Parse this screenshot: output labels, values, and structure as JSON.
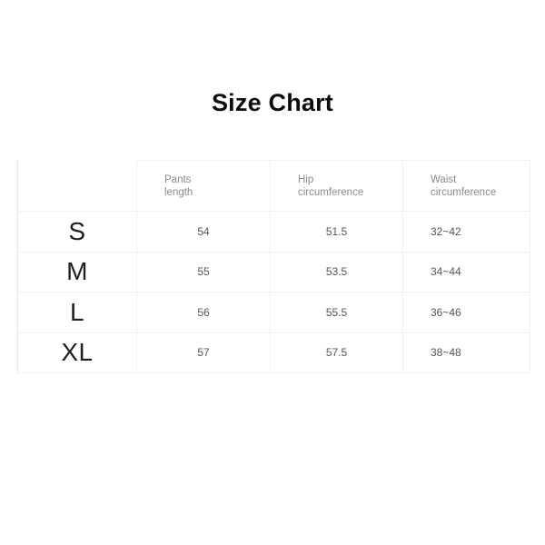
{
  "page": {
    "title": "Size Chart",
    "background_color": "#ffffff",
    "title_color": "#0d0d0d",
    "grid_color": "#f0f0f0",
    "header_text_color": "#8a8a8a",
    "size_label_color": "#1f1f1f",
    "value_text_color": "#555555"
  },
  "table": {
    "corner_header": "",
    "columns": [
      {
        "key": "size",
        "label": ""
      },
      {
        "key": "pants",
        "label": "Pants length",
        "line1": "Pants",
        "line2": "length"
      },
      {
        "key": "hip",
        "label": "Hip circumference",
        "line1": "Hip",
        "line2": "circumference"
      },
      {
        "key": "waist",
        "label": "Waist circumference",
        "line1": "Waist",
        "line2": "circumference"
      }
    ],
    "rows": [
      {
        "size": "S",
        "pants": "54",
        "hip": "51.5",
        "waist": "32~42"
      },
      {
        "size": "M",
        "pants": "55",
        "hip": "53.5",
        "waist": "34~44"
      },
      {
        "size": "L",
        "pants": "56",
        "hip": "55.5",
        "waist": "36~46"
      },
      {
        "size": "XL",
        "pants": "57",
        "hip": "57.5",
        "waist": "38~48"
      }
    ]
  },
  "chart_data": {
    "type": "table",
    "title": "Size Chart",
    "columns": [
      "",
      "Pants length",
      "Hip circumference",
      "Waist circumference"
    ],
    "categories": [
      "S",
      "M",
      "L",
      "XL"
    ],
    "series": [
      {
        "name": "Pants length",
        "values": [
          54,
          55,
          56,
          57
        ]
      },
      {
        "name": "Hip circumference",
        "values": [
          51.5,
          53.5,
          55.5,
          57.5
        ]
      },
      {
        "name": "Waist circumference",
        "values": [
          "32~42",
          "34~44",
          "36~46",
          "38~48"
        ]
      }
    ],
    "rows": [
      [
        "S",
        "54",
        "51.5",
        "32~42"
      ],
      [
        "M",
        "55",
        "53.5",
        "34~44"
      ],
      [
        "L",
        "56",
        "55.5",
        "36~46"
      ],
      [
        "XL",
        "57",
        "57.5",
        "38~48"
      ]
    ],
    "xlabel": "",
    "ylabel": "",
    "grid": true,
    "legend": "none"
  }
}
